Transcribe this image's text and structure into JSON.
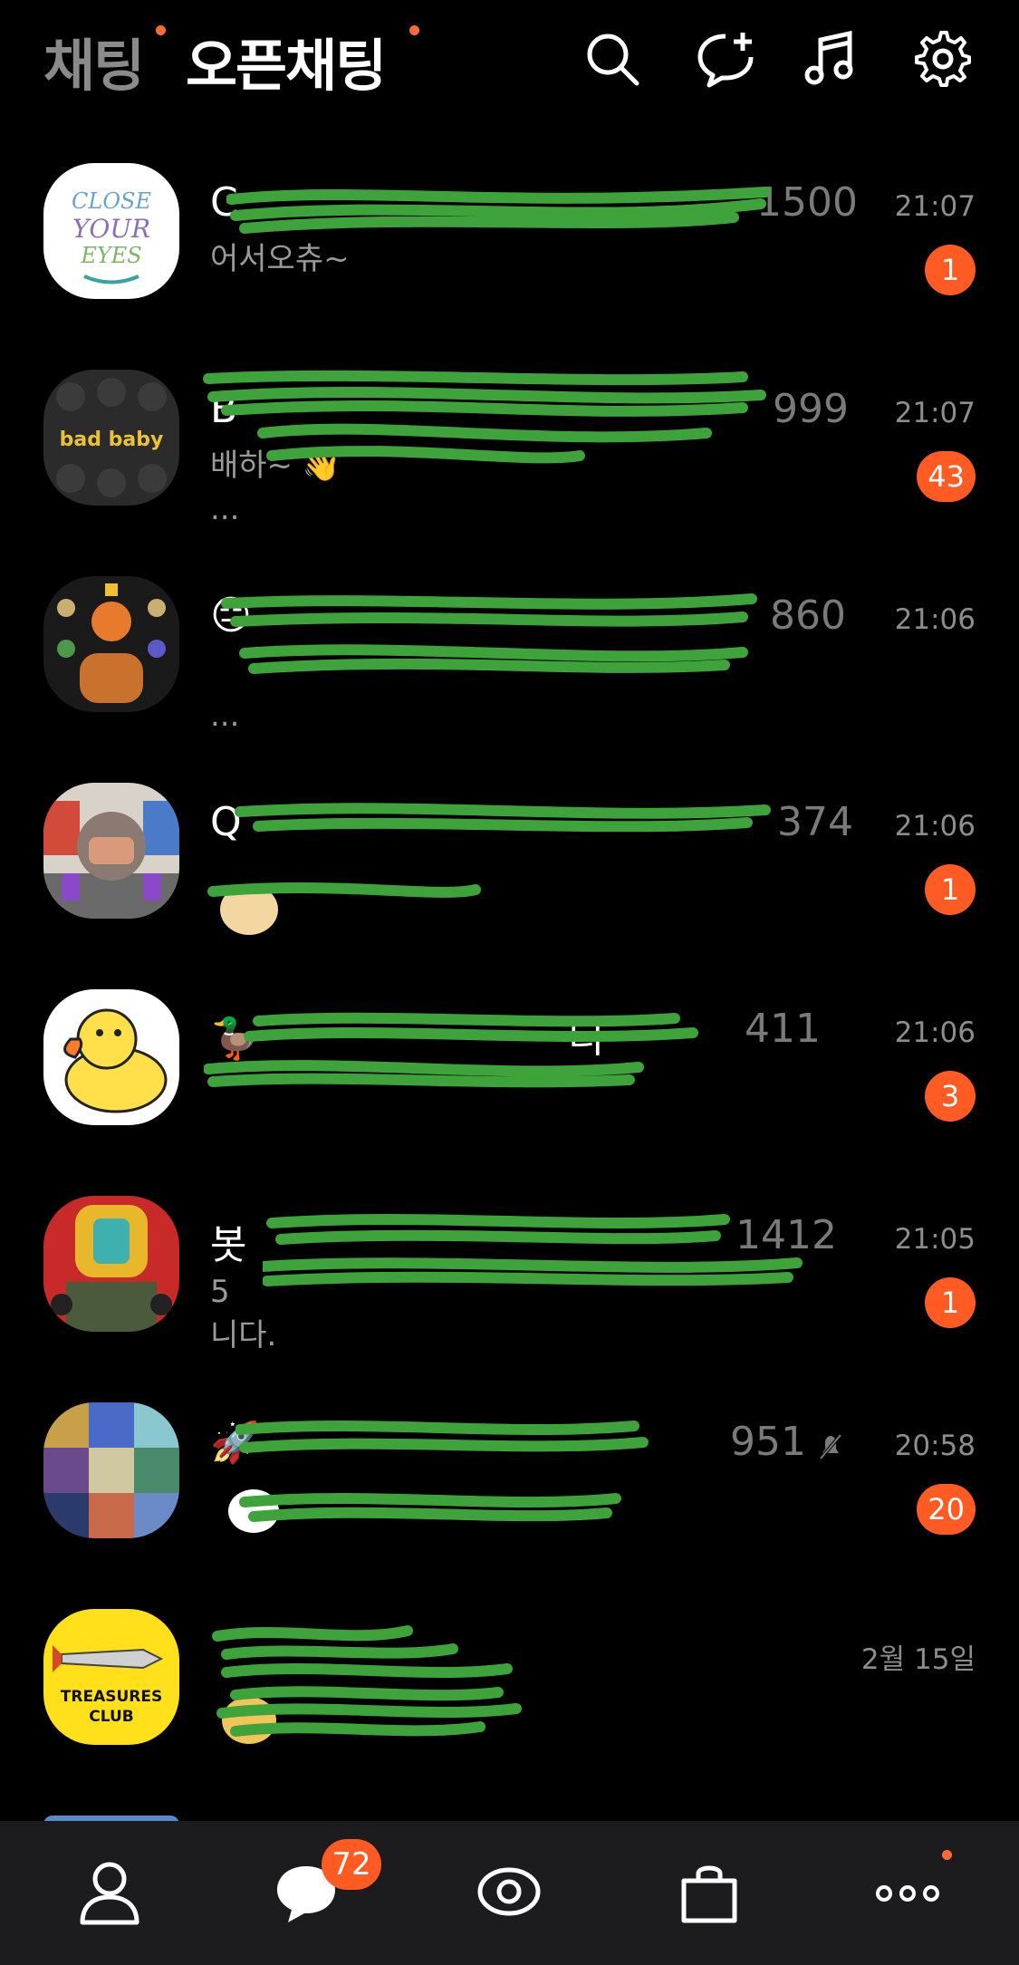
{
  "header": {
    "tabs": [
      {
        "label": "채팅"
      },
      {
        "label": "오픈채팅"
      }
    ],
    "icons": [
      "search-icon",
      "new-chat-icon",
      "music-icon",
      "settings-icon"
    ],
    "accent_color": "#ff5b22"
  },
  "chats": [
    {
      "title": "C",
      "count": "1500",
      "message": "어서오츄~",
      "time": "21:07",
      "badge": "1"
    },
    {
      "title": "B",
      "count": "999",
      "message": "배하~ 👋",
      "time": "21:07",
      "badge": "43",
      "ellipsis": "..."
    },
    {
      "title": "😑",
      "count": "860",
      "message": "",
      "time": "21:06",
      "badge": "",
      "ellipsis": "..."
    },
    {
      "title": "Q",
      "count": "374",
      "message": "",
      "time": "21:06",
      "badge": "1"
    },
    {
      "title": "🦆",
      "count": "411",
      "message": "",
      "time": "21:06",
      "badge": "3",
      "title_tail": "티"
    },
    {
      "title": "봇",
      "count": "1412",
      "message": "5",
      "time": "21:05",
      "badge": "1",
      "message_tail": "니다."
    },
    {
      "title": "🚀",
      "count": "951",
      "message": "",
      "time": "20:58",
      "badge": "20"
    },
    {
      "title": "",
      "count": "",
      "message": "",
      "time": "2월 15일",
      "badge": ""
    }
  ],
  "avatar_labels": {
    "close_your_eyes": "CLOSE YOUR EYES",
    "bad_baby": "bad baby",
    "treasures_club": "TREASURES CLUB"
  },
  "nav": {
    "items": [
      "friends-icon",
      "chats-icon",
      "view-icon",
      "shopping-icon",
      "more-icon"
    ],
    "chat_badge": "72"
  }
}
